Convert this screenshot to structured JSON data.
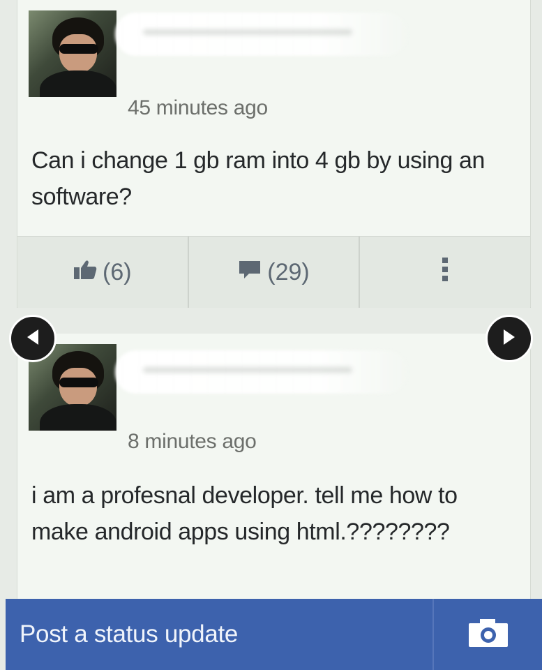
{
  "posts": [
    {
      "timestamp": "45 minutes ago",
      "text": "Can i change 1 gb ram into 4 gb by using an software?",
      "likes": "(6)",
      "comments": "(29)"
    },
    {
      "timestamp": "8 minutes ago",
      "text": "i am a profesnal developer. tell me how to make android apps using html.????????"
    }
  ],
  "icons": {
    "like": "thumbs-up-icon",
    "comment": "comment-bubble-icon",
    "more": "more-vertical-icon",
    "prev": "chevron-left-icon",
    "next": "chevron-right-icon",
    "camera": "camera-icon"
  },
  "composer": {
    "placeholder": "Post a status update"
  },
  "colors": {
    "card_bg": "#f3f7f2",
    "action_bar": "#e3e8e2",
    "status_bar": "#3d62ad",
    "action_text": "#5d6873"
  }
}
